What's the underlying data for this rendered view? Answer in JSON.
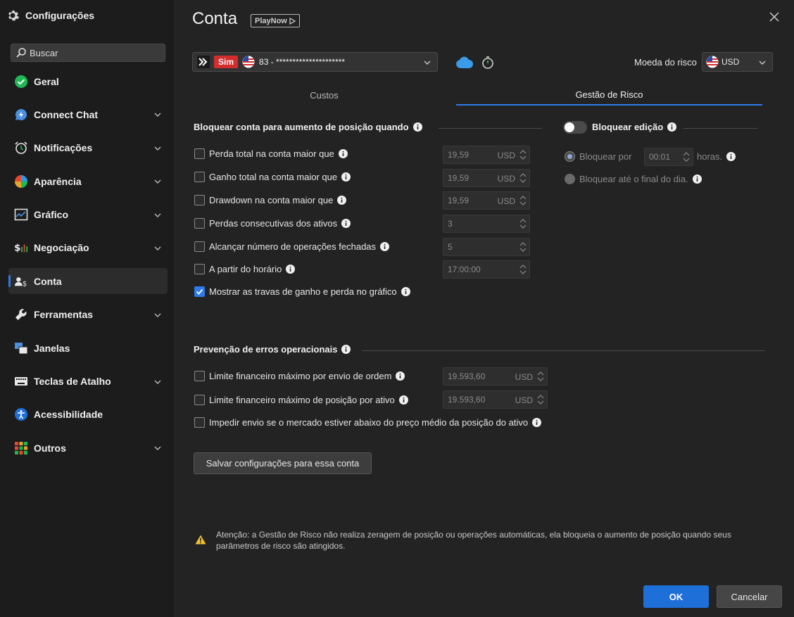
{
  "sidebar": {
    "title": "Configurações",
    "search_placeholder": "Buscar",
    "items": [
      {
        "label": "Geral"
      },
      {
        "label": "Connect Chat"
      },
      {
        "label": "Notificações"
      },
      {
        "label": "Aparência"
      },
      {
        "label": "Gráfico"
      },
      {
        "label": "Negociação"
      },
      {
        "label": "Conta"
      },
      {
        "label": "Ferramentas"
      },
      {
        "label": "Janelas"
      },
      {
        "label": "Teclas de Atalho"
      },
      {
        "label": "Acessibilidade"
      },
      {
        "label": "Outros"
      }
    ]
  },
  "header": {
    "title": "Conta",
    "badge": "PlayNow"
  },
  "account": {
    "sim_label": "Sim",
    "number": "83 - *********************",
    "currency_label": "Moeda do risco",
    "currency": "USD"
  },
  "tabs": [
    "Custos",
    "Gestão de Risco"
  ],
  "lock_section": {
    "title": "Bloquear conta para aumento de posição quando",
    "rows": [
      {
        "label": "Perda total na conta maior que",
        "value": "19,59",
        "unit": "USD"
      },
      {
        "label": "Ganho total na conta maior que",
        "value": "19,59",
        "unit": "USD"
      },
      {
        "label": "Drawdown na conta maior que",
        "value": "19,59",
        "unit": "USD"
      },
      {
        "label": "Perdas consecutivas dos ativos",
        "value": "3",
        "unit": ""
      },
      {
        "label": "Alcançar número de operações fechadas",
        "value": "5",
        "unit": ""
      },
      {
        "label": "A partir do horário",
        "value": "17:00:00",
        "unit": ""
      }
    ],
    "show_locks": "Mostrar as travas de ganho e perda no gráfico"
  },
  "edit_lock": {
    "title": "Bloquear edição",
    "block_for": "Bloquear por",
    "block_for_value": "00:01",
    "hours": "horas.",
    "until_end": "Bloquear até o final do dia."
  },
  "errors_section": {
    "title": "Prevenção de erros operacionais",
    "rows": [
      {
        "label": "Limite financeiro máximo por envio de ordem",
        "value": "19.593,60",
        "unit": "USD"
      },
      {
        "label": "Limite financeiro máximo de posição por ativo",
        "value": "19.593,60",
        "unit": "USD"
      }
    ],
    "prevent": "Impedir envio se o mercado estiver abaixo do preço médio da posição do ativo"
  },
  "save_button": "Salvar configurações para essa conta",
  "warning": "Atenção: a Gestão de Risco não realiza zeragem de posição ou operações automáticas, ela bloqueia o aumento de posição quando seus parâmetros de risco são atingidos.",
  "buttons": {
    "ok": "OK",
    "cancel": "Cancelar"
  },
  "colors": {
    "accent": "#2d7be6",
    "sim_red": "#d42d2d",
    "background": "#232323",
    "sidebar": "#1c1c1c"
  }
}
